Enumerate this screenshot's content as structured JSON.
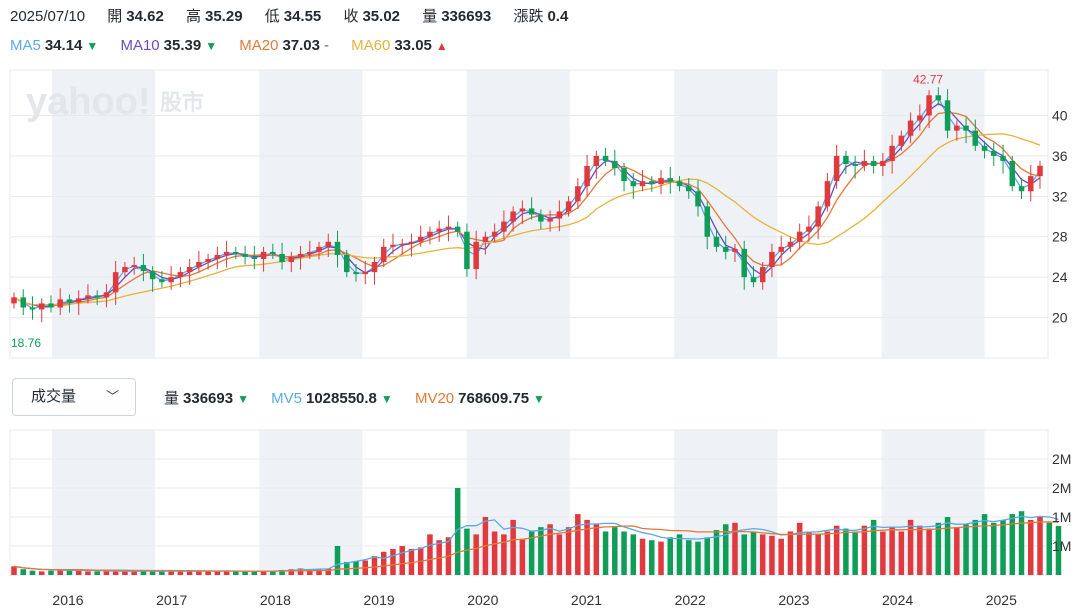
{
  "header": {
    "date": "2025/07/10",
    "items": [
      {
        "label": "開",
        "value": "34.62"
      },
      {
        "label": "高",
        "value": "35.29"
      },
      {
        "label": "低",
        "value": "34.55"
      },
      {
        "label": "收",
        "value": "35.02"
      },
      {
        "label": "量",
        "value": "336693"
      },
      {
        "label": "漲跌",
        "value": "0.4"
      }
    ]
  },
  "ma": [
    {
      "label": "MA5",
      "value": "34.14",
      "dir": "down",
      "color": "#5aa9e6"
    },
    {
      "label": "MA10",
      "value": "35.39",
      "dir": "down",
      "color": "#6a4cc1"
    },
    {
      "label": "MA20",
      "value": "37.03",
      "dir": "flat",
      "color": "#e07a3a"
    },
    {
      "label": "MA60",
      "value": "33.05",
      "dir": "up",
      "color": "#e8b23a"
    }
  ],
  "volume_bar": {
    "select_label": "成交量",
    "vol_label": "量",
    "vol_value": "336693",
    "mv5_label": "MV5",
    "mv5_value": "1028550.8",
    "mv20_label": "MV20",
    "mv20_value": "768609.75",
    "mv5_color": "#5aa9e6",
    "mv20_color": "#e07a3a"
  },
  "watermark": {
    "brand": "yahoo!",
    "suffix": "股市"
  },
  "colors": {
    "up": "#e0393e",
    "down": "#0f9d58",
    "shade": "#eef2f7",
    "grid": "#e6e9ee"
  },
  "chart_data": {
    "type": "candlestick",
    "x_tick_labels": [
      "2016",
      "2017",
      "2018",
      "2019",
      "2020",
      "2021",
      "2022",
      "2023",
      "2024",
      "2025"
    ],
    "price_ticks": [
      "20",
      "24",
      "28",
      "32",
      "36",
      "40"
    ],
    "price_ylim": [
      16.0,
      44.5
    ],
    "volume_ticks": [
      "1M",
      "1M",
      "2M",
      "2M"
    ],
    "max_label": "42.77",
    "min_label": "18.76",
    "ma_labels": [
      "MA5",
      "MA10",
      "MA20",
      "MA60"
    ],
    "mv_labels": [
      "MV5",
      "MV20"
    ],
    "candles_close": [
      22.0,
      21.0,
      20.8,
      21.4,
      21.0,
      21.8,
      21.5,
      21.9,
      22.2,
      22.0,
      22.5,
      24.5,
      25.0,
      25.2,
      24.6,
      23.8,
      23.5,
      24.0,
      24.5,
      25.0,
      25.5,
      25.8,
      26.2,
      26.5,
      26.3,
      26.0,
      25.8,
      26.5,
      26.3,
      25.5,
      26.0,
      26.3,
      26.5,
      27.0,
      27.5,
      26.2,
      24.5,
      24.3,
      24.5,
      25.5,
      27.0,
      27.2,
      27.3,
      27.5,
      28.0,
      28.5,
      28.8,
      29.0,
      28.5,
      24.8,
      27.5,
      28.0,
      28.5,
      29.5,
      30.5,
      30.8,
      30.2,
      29.5,
      29.8,
      30.5,
      31.5,
      33.0,
      35.0,
      36.0,
      35.5,
      34.8,
      33.5,
      33.0,
      33.5,
      33.2,
      33.8,
      33.5,
      33.0,
      32.5,
      31.0,
      28.0,
      27.0,
      26.5,
      26.8,
      24.0,
      23.5,
      25.0,
      26.5,
      27.0,
      27.5,
      28.5,
      29.0,
      31.0,
      33.5,
      36.0,
      35.2,
      35.0,
      35.5,
      35.0,
      35.5,
      37.0,
      38.0,
      39.5,
      40.0,
      42.0,
      41.5,
      38.5,
      39.0,
      38.5,
      37.0,
      36.5,
      36.0,
      35.5,
      33.0,
      32.5,
      34.0,
      35.02
    ],
    "volume_values": [
      60,
      40,
      30,
      25,
      30,
      40,
      35,
      30,
      25,
      25,
      25,
      30,
      25,
      25,
      30,
      25,
      25,
      30,
      25,
      25,
      30,
      25,
      25,
      30,
      25,
      25,
      25,
      30,
      30,
      35,
      40,
      45,
      40,
      40,
      45,
      200,
      90,
      95,
      100,
      130,
      160,
      180,
      200,
      180,
      190,
      280,
      240,
      260,
      600,
      320,
      280,
      400,
      300,
      280,
      380,
      250,
      300,
      330,
      350,
      280,
      330,
      420,
      380,
      350,
      300,
      330,
      300,
      280,
      250,
      240,
      230,
      260,
      280,
      240,
      230,
      260,
      310,
      350,
      360,
      280,
      300,
      280,
      270,
      250,
      300,
      360,
      300,
      280,
      300,
      340,
      320,
      300,
      340,
      380,
      300,
      330,
      300,
      380,
      340,
      320,
      360,
      400,
      330,
      350,
      380,
      420,
      360,
      380,
      420,
      440,
      380,
      400,
      360,
      338
    ]
  }
}
